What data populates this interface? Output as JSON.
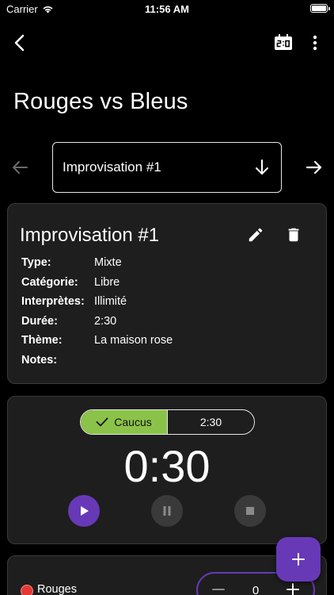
{
  "status_bar": {
    "carrier": "Carrier",
    "time": "11:56 AM"
  },
  "nav": {
    "back_icon": "chevron-left-icon",
    "score_icon": "scoreboard-icon",
    "more_icon": "more-vertical-icon"
  },
  "page_title": "Rouges vs Bleus",
  "selector": {
    "value": "Improvisation #1"
  },
  "improv": {
    "title": "Improvisation #1",
    "details": [
      {
        "key": "Type:",
        "value": "Mixte"
      },
      {
        "key": "Catégorie:",
        "value": "Libre"
      },
      {
        "key": "Interprètes:",
        "value": "Illimité"
      },
      {
        "key": "Durée:",
        "value": "2:30"
      },
      {
        "key": "Thème:",
        "value": "La maison rose"
      },
      {
        "key": "Notes:",
        "value": ""
      }
    ]
  },
  "timer": {
    "segments": [
      {
        "label": "Caucus",
        "selected": true
      },
      {
        "label": "2:30",
        "selected": false
      }
    ],
    "display": "0:30"
  },
  "team": {
    "name": "Rouges",
    "score": "0",
    "color": "#e53935"
  },
  "colors": {
    "accent": "#6739b7",
    "caucus_selected": "#8bc34a",
    "card_bg": "#1e1e1e"
  }
}
